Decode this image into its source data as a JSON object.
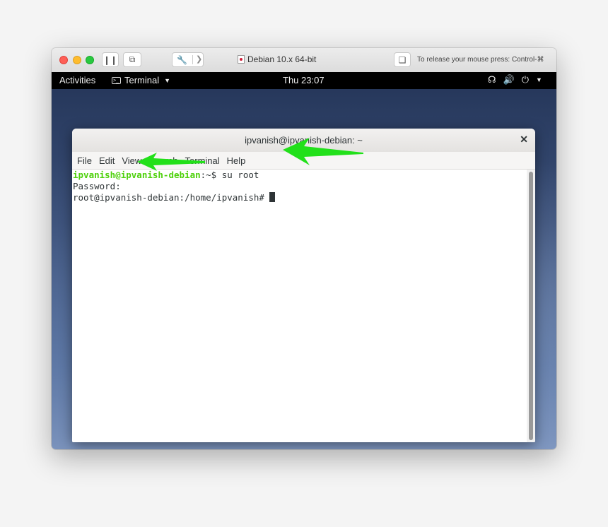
{
  "vm_window": {
    "title": "Debian 10.x 64-bit",
    "release_hint": "To release your mouse press: Control-⌘"
  },
  "gnome": {
    "activities": "Activities",
    "app_menu": "Terminal",
    "clock": "Thu 23:07",
    "tray_icons": [
      "network-icon",
      "volume-icon",
      "power-icon",
      "chevron-down-icon"
    ]
  },
  "terminal": {
    "title": "ipvanish@ipvanish-debian: ~",
    "menu": [
      "File",
      "Edit",
      "View",
      "Search",
      "Terminal",
      "Help"
    ],
    "line1_user": "ipvanish@ipvanish-debian",
    "line1_rest": ":~$ su root",
    "line2": "Password:",
    "line3": "root@ipvanish-debian:/home/ipvanish# "
  },
  "colors": {
    "annotation_arrow": "#22e01a",
    "prompt_user": "#4ed10c"
  }
}
